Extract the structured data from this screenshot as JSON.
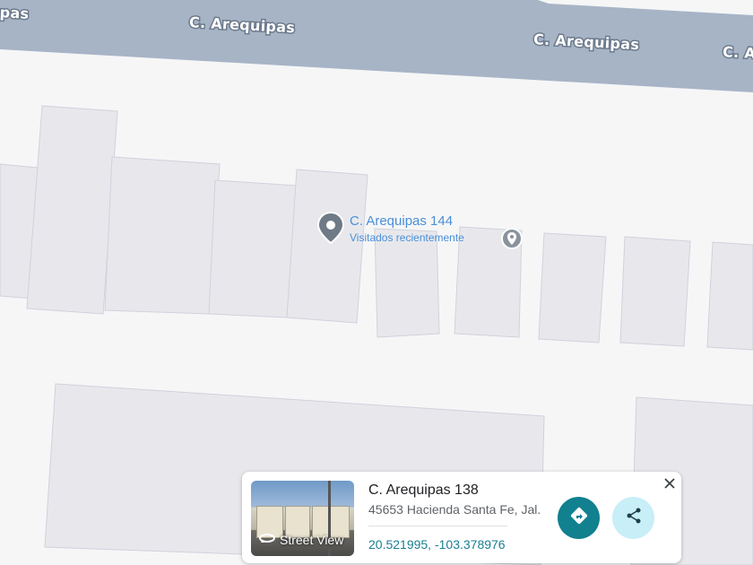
{
  "map": {
    "street_labels": [
      "ipas",
      "C. Arequipas",
      "C. Arequipas",
      "C. A"
    ]
  },
  "place": {
    "title": "C. Arequipas 144",
    "subtitle": "Visitados recientemente",
    "pin_icon": "map-pin-icon",
    "marker_icon": "location-marker-icon"
  },
  "card": {
    "title": "C. Arequipas 138",
    "address": "45653 Hacienda Santa Fe, Jal.",
    "coordinates": "20.521995, -103.378976",
    "street_view_label": "Street View",
    "icons": {
      "street_view": "street-view-360-icon",
      "directions": "directions-icon",
      "share": "share-icon",
      "close": "close-icon"
    },
    "colors": {
      "directions_button": "#11808f",
      "share_button": "#c8eef8",
      "coords_text": "#1a7f92"
    }
  }
}
